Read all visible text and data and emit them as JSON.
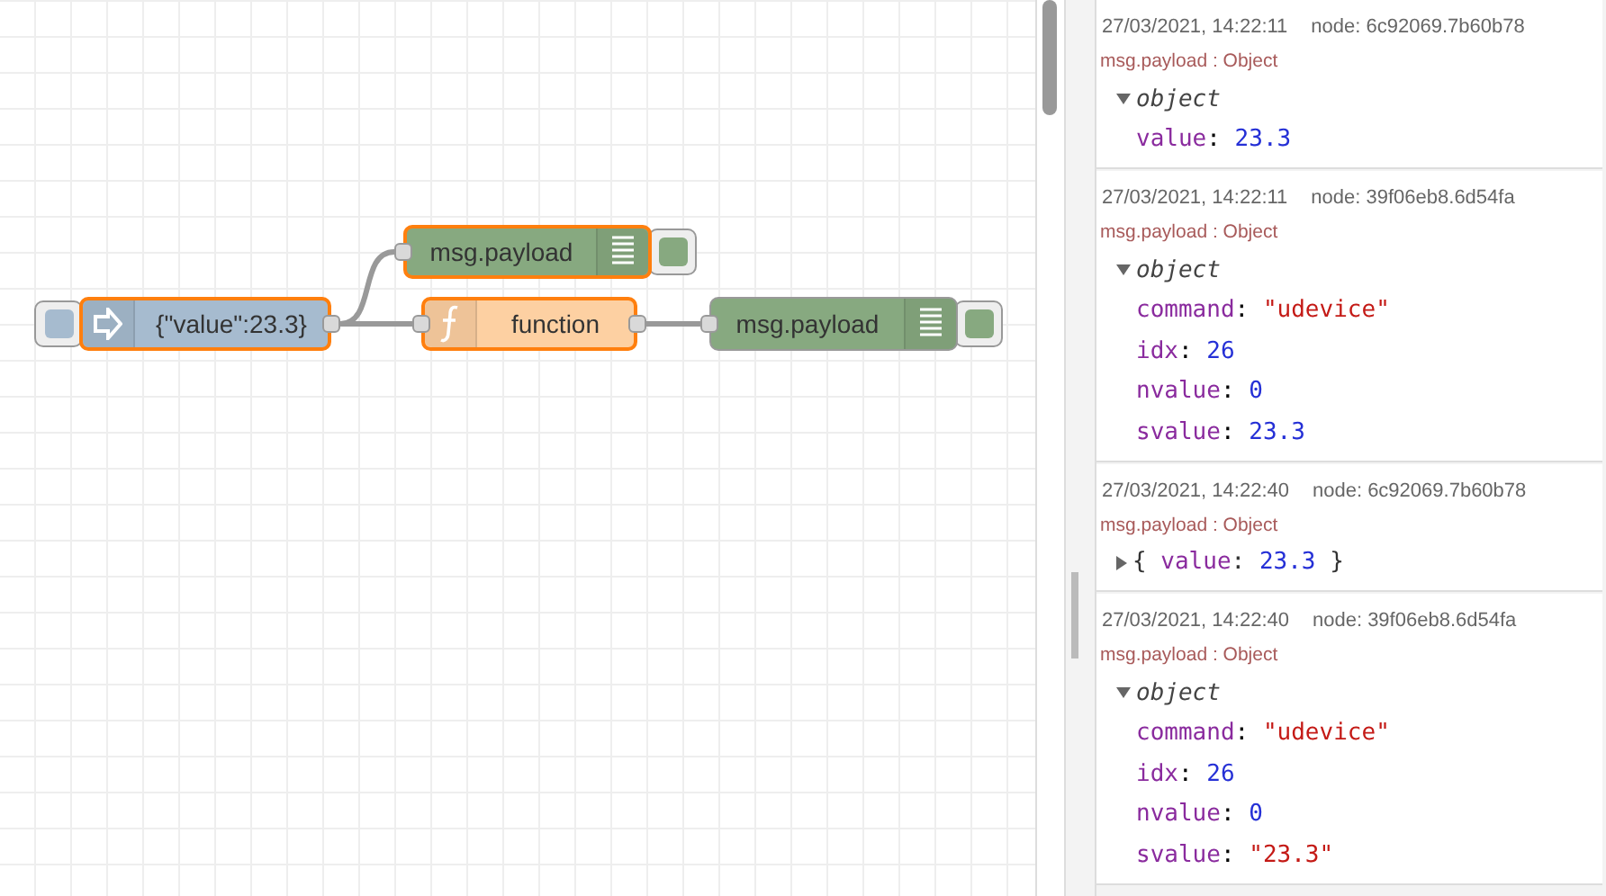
{
  "flow": {
    "nodes": [
      {
        "kind": "inject",
        "label": "{\"value\":23.3}",
        "selected": true
      },
      {
        "kind": "debug",
        "label": "msg.payload",
        "selected": true
      },
      {
        "kind": "function",
        "label": "function",
        "selected": true
      },
      {
        "kind": "debug",
        "label": "msg.payload",
        "selected": false
      }
    ]
  },
  "debug": {
    "messages": [
      {
        "time": "27/03/2021, 14:22:11",
        "node": "node: 6c92069.7b60b78",
        "label": "msg.payload : Object",
        "expanded": true,
        "root": "object",
        "props": [
          {
            "key": "value",
            "sep": ":",
            "value": "23.3",
            "kind": "number"
          }
        ]
      },
      {
        "time": "27/03/2021, 14:22:11",
        "node": "node: 39f06eb8.6d54fa",
        "label": "msg.payload : Object",
        "expanded": true,
        "root": "object",
        "props": [
          {
            "key": "command",
            "sep": ":",
            "value": "\"udevice\"",
            "kind": "string"
          },
          {
            "key": "idx",
            "sep": ":",
            "value": "26",
            "kind": "number"
          },
          {
            "key": "nvalue",
            "sep": ":",
            "value": "0",
            "kind": "number"
          },
          {
            "key": "svalue",
            "sep": ":",
            "value": "23.3",
            "kind": "number"
          }
        ]
      },
      {
        "time": "27/03/2021, 14:22:40",
        "node": "node: 6c92069.7b60b78",
        "label": "msg.payload : Object",
        "expanded": false,
        "brace_open": "{",
        "brace_close": "}",
        "props": [
          {
            "key": "value",
            "sep": ":",
            "value": "23.3",
            "kind": "number"
          }
        ]
      },
      {
        "time": "27/03/2021, 14:22:40",
        "node": "node: 39f06eb8.6d54fa",
        "label": "msg.payload : Object",
        "expanded": true,
        "root": "object",
        "props": [
          {
            "key": "command",
            "sep": ":",
            "value": "\"udevice\"",
            "kind": "string"
          },
          {
            "key": "idx",
            "sep": ":",
            "value": "26",
            "kind": "number"
          },
          {
            "key": "nvalue",
            "sep": ":",
            "value": "0",
            "kind": "number"
          },
          {
            "key": "svalue",
            "sep": ":",
            "value": "\"23.3\"",
            "kind": "string"
          }
        ]
      }
    ]
  }
}
